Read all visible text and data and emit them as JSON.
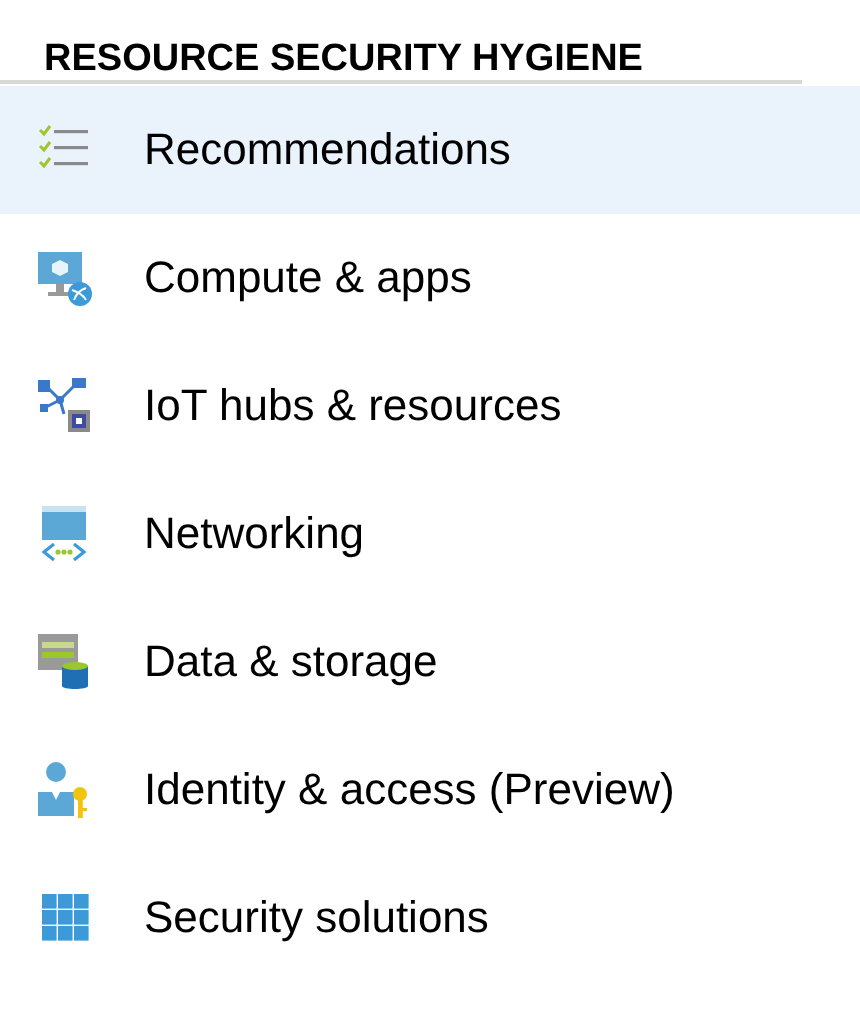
{
  "heading": "RESOURCE SECURITY HYGIENE",
  "items": [
    {
      "label": "Recommendations",
      "kind": "checklist",
      "selected": true
    },
    {
      "label": "Compute & apps",
      "kind": "compute",
      "selected": false
    },
    {
      "label": "IoT hubs & resources",
      "kind": "iot",
      "selected": false
    },
    {
      "label": "Networking",
      "kind": "network",
      "selected": false
    },
    {
      "label": "Data & storage",
      "kind": "data",
      "selected": false
    },
    {
      "label": "Identity & access (Preview)",
      "kind": "identity",
      "selected": false
    },
    {
      "label": "Security solutions",
      "kind": "solutions",
      "selected": false
    }
  ]
}
